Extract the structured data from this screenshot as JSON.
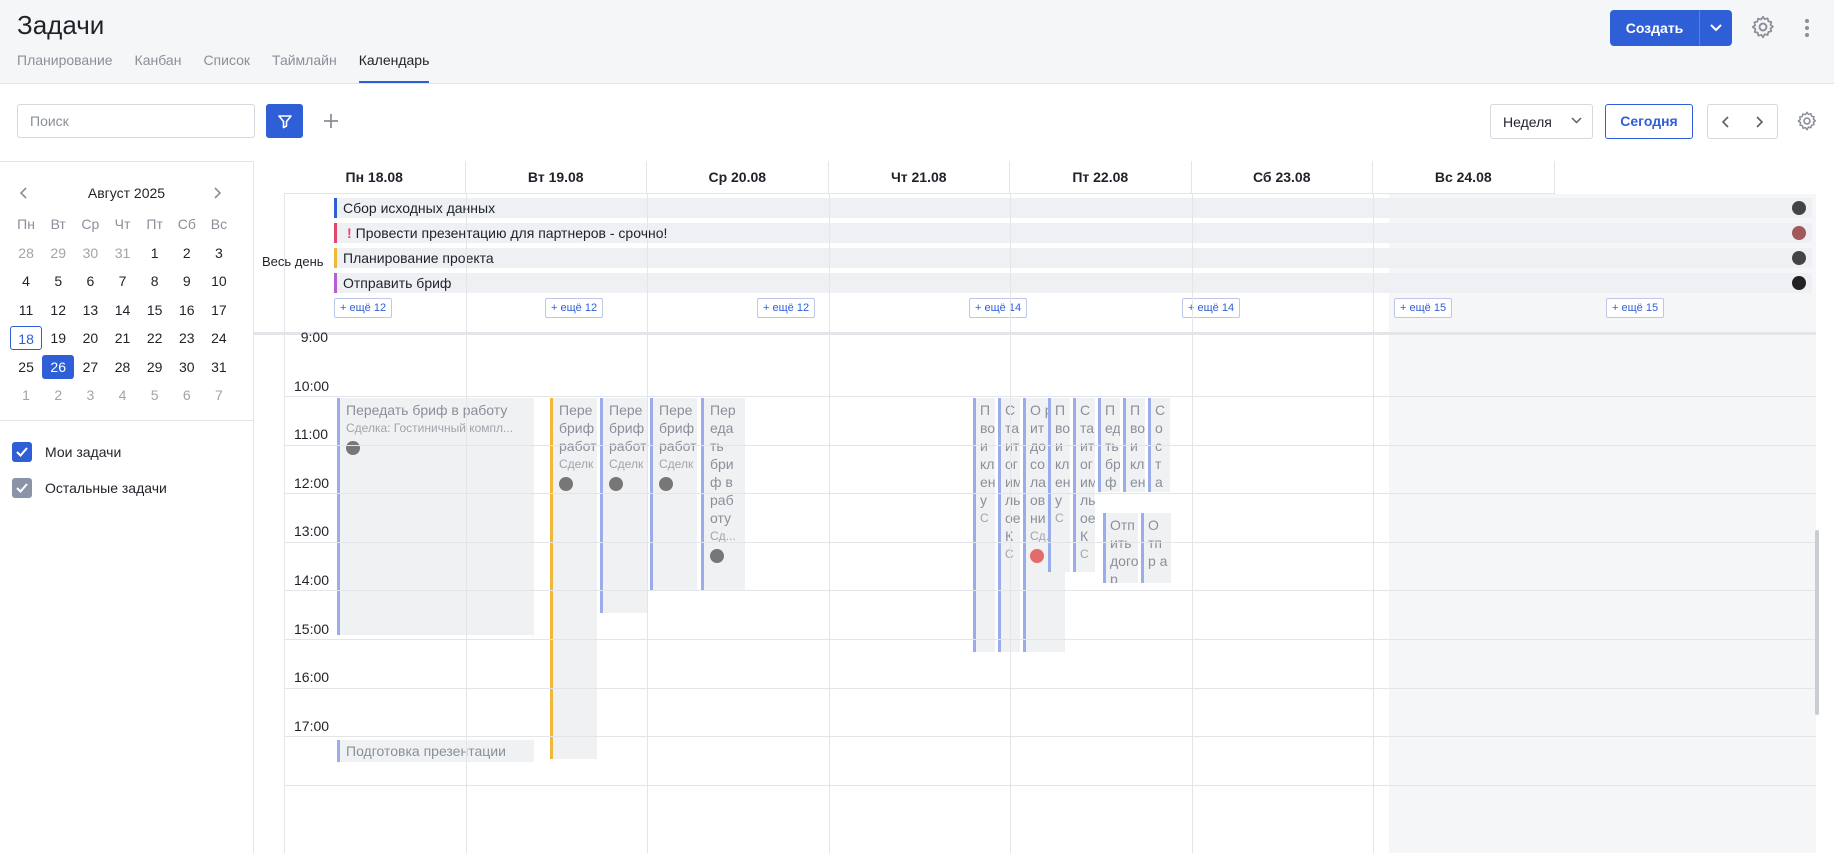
{
  "header": {
    "title": "Задачи",
    "tabs": [
      "Планирование",
      "Канбан",
      "Список",
      "Таймлайн",
      "Календарь"
    ],
    "active_tab": "Календарь",
    "create_label": "Создать"
  },
  "toolbar": {
    "search_placeholder": "Поиск",
    "view": "Неделя",
    "today": "Сегодня"
  },
  "minical": {
    "month": "Август 2025",
    "dow": [
      "Пн",
      "Вт",
      "Ср",
      "Чт",
      "Пт",
      "Сб",
      "Вс"
    ],
    "weeks": [
      [
        "28",
        "29",
        "30",
        "31",
        "1",
        "2",
        "3"
      ],
      [
        "4",
        "5",
        "6",
        "7",
        "8",
        "9",
        "10"
      ],
      [
        "11",
        "12",
        "13",
        "14",
        "15",
        "16",
        "17"
      ],
      [
        "18",
        "19",
        "20",
        "21",
        "22",
        "23",
        "24"
      ],
      [
        "25",
        "26",
        "27",
        "28",
        "29",
        "30",
        "31"
      ],
      [
        "1",
        "2",
        "3",
        "4",
        "5",
        "6",
        "7"
      ]
    ],
    "today": "18",
    "selected": "26"
  },
  "filters": {
    "my": "Мои задачи",
    "other": "Остальные задачи"
  },
  "days": [
    "Пн 18.08",
    "Вт 19.08",
    "Ср 20.08",
    "Чт 21.08",
    "Пт 22.08",
    "Сб 23.08",
    "Вс 24.08"
  ],
  "allday": {
    "label": "Весь день",
    "events": [
      {
        "title": "Сбор исходных данных",
        "color": "#2f5fd6",
        "urgent": false
      },
      {
        "title": "Провести презентацию для партнеров - срочно!",
        "color": "#e0466e",
        "urgent": true
      },
      {
        "title": "Планирование проекта",
        "color": "#f0b73a",
        "urgent": false
      },
      {
        "title": "Отправить бриф",
        "color": "#b55fd0",
        "urgent": false
      }
    ],
    "more": [
      "+ ещё 12",
      "+ ещё 12",
      "+ ещё 12",
      "+ ещё 14",
      "+ ещё 14",
      "+ ещё 15",
      "+ ещё 15"
    ]
  },
  "hours": [
    "9:00",
    "10:00",
    "11:00",
    "12:00",
    "13:00",
    "14:00",
    "15:00",
    "16:00",
    "17:00"
  ],
  "events": {
    "mon1": {
      "title": "Передать бриф в работу",
      "sub": "Сделка: Гостиничный компл..."
    },
    "mon2": {
      "title": "Подготовка презентации"
    },
    "tue1": {
      "title": "Пере бриф работ",
      "sub": "Сделк"
    },
    "tue2": {
      "title": "Пере бриф работ",
      "sub": "Сделк"
    },
    "tue3": {
      "title": "Пере бриф работ",
      "sub": "Сделк"
    },
    "tue4": {
      "title": "Пер еда ть бри ф в раб оту",
      "sub": "Сд..."
    },
    "thu1": {
      "title": "П во и кл ен у",
      "sub": "С"
    },
    "thu2": {
      "title": "С та ит ог им ль ое К",
      "sub": "С"
    },
    "thu3": {
      "title": "О ра ит до р со ла ов ни",
      "sub": "Сд..."
    },
    "thu4": {
      "title": "П во и кл ен у",
      "sub": "С"
    },
    "thu5": {
      "title": "С та ит ог им льн ое К",
      "sub": "С"
    },
    "thu6": {
      "title": "П ед ть бр ф"
    },
    "thu7": {
      "title": "П во и кл ен"
    },
    "thu8": {
      "title": "С о с т а"
    },
    "thu9": {
      "title": "Отп ить дого р на"
    },
    "thu10": {
      "title": "О тп р а"
    }
  },
  "colors": {
    "accent": "#2f5fd6",
    "event_border": "#9aadea",
    "event_yellow": "#f0b73a",
    "weekend_bg": "#f5f6f8"
  }
}
